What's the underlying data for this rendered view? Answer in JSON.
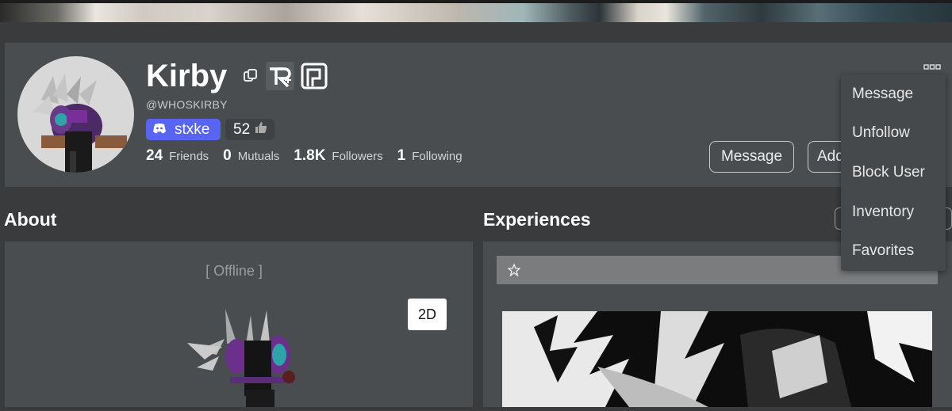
{
  "profile": {
    "display_name": "Kirby",
    "handle": "@WHOSKIRBY",
    "discord_tag": "stxke",
    "likes": "52",
    "stats": [
      {
        "value": "24",
        "label": "Friends"
      },
      {
        "value": "0",
        "label": "Mutuals"
      },
      {
        "value": "1.8K",
        "label": "Followers"
      },
      {
        "value": "1",
        "label": "Following"
      }
    ],
    "message_button": "Message",
    "add_button": "Add"
  },
  "menu": {
    "items": [
      "Message",
      "Unfollow",
      "Block User",
      "Inventory",
      "Favorites"
    ]
  },
  "about": {
    "title": "About",
    "status": "[ Offline ]",
    "view_toggle": "2D"
  },
  "experiences": {
    "title": "Experiences"
  },
  "colors": {
    "background": "#393b3d",
    "card": "#4a4d50",
    "discord": "#5865f2",
    "accent_text": "#ffffff"
  },
  "icons": [
    "copy-icon",
    "badge-r-icon",
    "badge-p-icon",
    "discord-icon",
    "thumbs-up-icon",
    "more-icon",
    "star-icon"
  ]
}
